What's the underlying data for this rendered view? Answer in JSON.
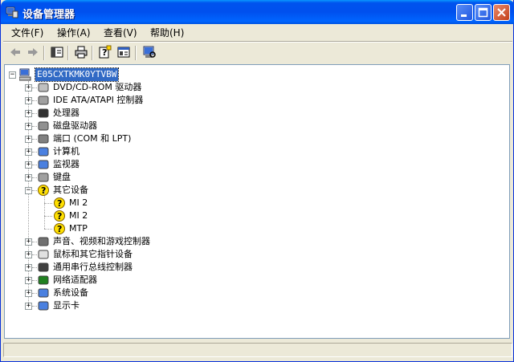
{
  "window": {
    "title": "设备管理器"
  },
  "menu": {
    "file": "文件(F)",
    "action": "操作(A)",
    "view": "查看(V)",
    "help": "帮助(H)"
  },
  "toolbar": {
    "back": "back-icon",
    "forward": "forward-icon"
  },
  "tree": {
    "root": "E05CXTKMK0YTVBW",
    "items": [
      "DVD/CD-ROM 驱动器",
      "IDE ATA/ATAPI 控制器",
      "处理器",
      "磁盘驱动器",
      "端口 (COM 和 LPT)",
      "计算机",
      "监视器",
      "键盘",
      "其它设备",
      "声音、视频和游戏控制器",
      "鼠标和其它指针设备",
      "通用串行总线控制器",
      "网络适配器",
      "系统设备",
      "显示卡"
    ],
    "other_children": [
      "MI 2",
      "MI 2",
      "MTP"
    ]
  },
  "colors": {
    "titlebar": "#0053ee",
    "selection": "#316ac5",
    "chrome": "#ece9d8"
  }
}
